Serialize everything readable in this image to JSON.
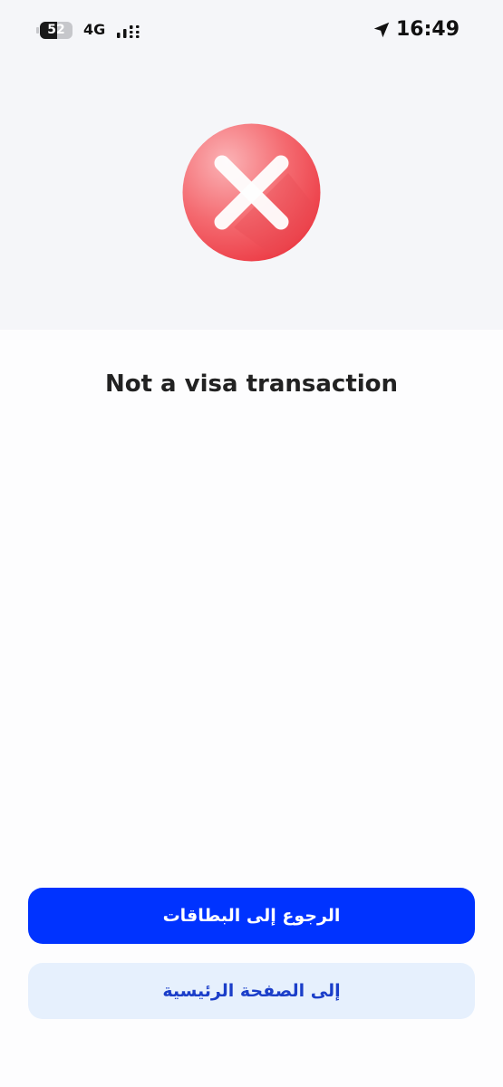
{
  "status_bar": {
    "battery": 52,
    "network": "4G",
    "time": "16:49"
  },
  "result": {
    "icon": "error-x-icon",
    "message": "Not a visa transaction"
  },
  "actions": {
    "primary_label": "الرجوع إلى البطاقات",
    "secondary_label": "إلى الصفحة الرئيسية"
  },
  "colors": {
    "primary": "#0033ff",
    "secondary_bg": "#e6f0fd",
    "secondary_text": "#1b3ec9",
    "error": "#f0474f"
  }
}
